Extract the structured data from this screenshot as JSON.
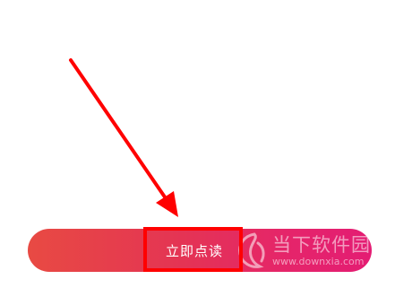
{
  "button": {
    "label": "立即点读"
  },
  "watermark": {
    "title": "当下软件园",
    "url": "www.downxia.com"
  },
  "colors": {
    "bar_start": "#e84a43",
    "bar_end": "#e41c73",
    "annotation": "#ff0000",
    "label": "#ffffff"
  },
  "icons": {
    "arrow": "arrow-pointer-icon",
    "watermark_logo": "downxia-logo-icon"
  }
}
